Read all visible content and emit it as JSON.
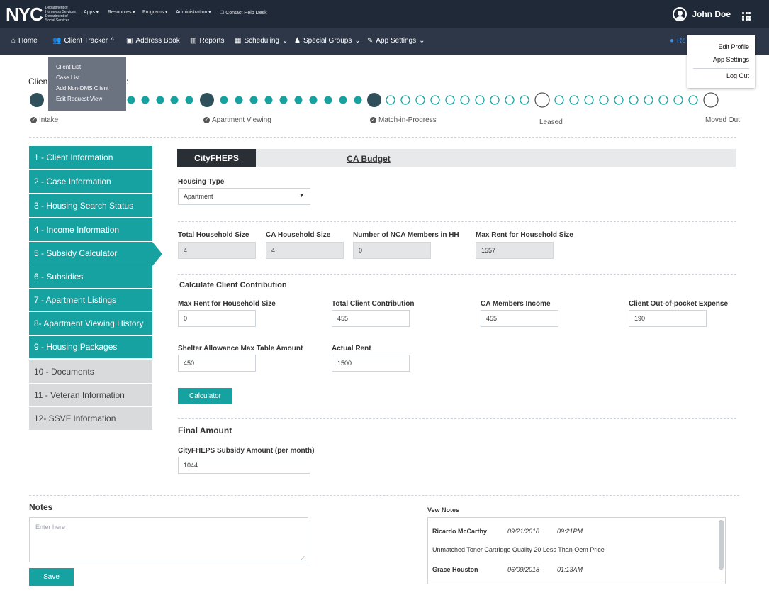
{
  "topbar": {
    "logo_text": "NYC",
    "logo_sub": "Department of Homeless Services Department of Social Services",
    "nav": [
      "Apps",
      "Resources",
      "Programs",
      "Administration",
      "Contact Help Desk"
    ],
    "user_name": "John Doe"
  },
  "navbar": {
    "items": [
      {
        "label": "Home",
        "icon": "home-icon"
      },
      {
        "label": "Client Tracker",
        "icon": "users-icon"
      },
      {
        "label": "Address Book",
        "icon": "address-book-icon"
      },
      {
        "label": "Reports",
        "icon": "bar-chart-icon"
      },
      {
        "label": "Scheduling",
        "icon": "calendar-icon"
      },
      {
        "label": "Special Groups",
        "icon": "user-icon"
      },
      {
        "label": "App Settings",
        "icon": "wrench-icon"
      }
    ],
    "right_partial": "Re"
  },
  "client_tracker_menu": [
    "Client List",
    "Case List",
    "Add Non-DMS Client",
    "Edit Request View"
  ],
  "user_menu": [
    "Edit Profile",
    "App Settings",
    "Log Out"
  ],
  "progress": {
    "title_partial": "Clien",
    "title_suffix": ":",
    "steps": [
      {
        "label": "Intake",
        "checked": true
      },
      {
        "label": "Apartment Viewing",
        "checked": true
      },
      {
        "label": "Match-in-Progress",
        "checked": true
      },
      {
        "label": "Leased",
        "checked": false
      },
      {
        "label": "Moved Out",
        "checked": false
      }
    ],
    "color_done": "#17a2a2",
    "color_milestone": "#2f4f5a"
  },
  "sidebar": {
    "items": [
      {
        "label": "1 - Client Information",
        "state": "teal"
      },
      {
        "label": "2 - Case Information",
        "state": "teal"
      },
      {
        "label": "3 - Housing Search Status",
        "state": "teal"
      },
      {
        "label": "4 - Income Information",
        "state": "teal"
      },
      {
        "label": "5 - Subsidy Calculator",
        "state": "active"
      },
      {
        "label": "6 - Subsidies",
        "state": "teal"
      },
      {
        "label": "7 - Apartment Listings",
        "state": "teal"
      },
      {
        "label": "8- Apartment Viewing History",
        "state": "teal"
      },
      {
        "label": "9 - Housing Packages",
        "state": "teal"
      },
      {
        "label": "10 - Documents",
        "state": "grey"
      },
      {
        "label": "11 - Veteran Information",
        "state": "grey"
      },
      {
        "label": "12- SSVF Information",
        "state": "grey"
      }
    ]
  },
  "tabs": {
    "citypheps": "CityFHEPS",
    "ca_budget": "CA Budget"
  },
  "form": {
    "housing_type_label": "Housing Type",
    "housing_type_value": "Apartment",
    "total_household_label": "Total Household  Size",
    "total_household_value": "4",
    "ca_household_label": "CA Household Size",
    "ca_household_value": "4",
    "nca_members_label": "Number of NCA Members in HH",
    "nca_members_value": "0",
    "max_rent_label": "Max Rent for Household Size",
    "max_rent_value": "1557",
    "calc_title": "Calculate Client Contribution",
    "cc_max_rent_label": "Max Rent for Household Size",
    "cc_max_rent_value": "0",
    "total_contribution_label": "Total Client Contribution",
    "total_contribution_value": "455",
    "ca_income_label": "CA Members Income",
    "ca_income_value": "455",
    "oop_label": "Client Out-of-pocket Expense",
    "oop_value": "190",
    "shelter_label": "Shelter Allowance Max Table Amount",
    "shelter_value": "450",
    "actual_rent_label": "Actual Rent",
    "actual_rent_value": "1500",
    "calculator_button": "Calculator",
    "final_title": "Final Amount",
    "subsidy_label": "CityFHEPS Subsidy Amount (per month)",
    "subsidy_value": "1044"
  },
  "notes": {
    "title": "Notes",
    "placeholder": "Enter here",
    "save_button": "Save",
    "view_title": "Vew Notes",
    "entries": [
      {
        "name": "Ricardo McCarthy",
        "date": "09/21/2018",
        "time": "09:21PM",
        "text": "Unmatched Toner Cartridge Quality 20 Less Than Oem Price"
      },
      {
        "name": "Grace Houston",
        "date": "06/09/2018",
        "time": "01:13AM"
      }
    ]
  }
}
